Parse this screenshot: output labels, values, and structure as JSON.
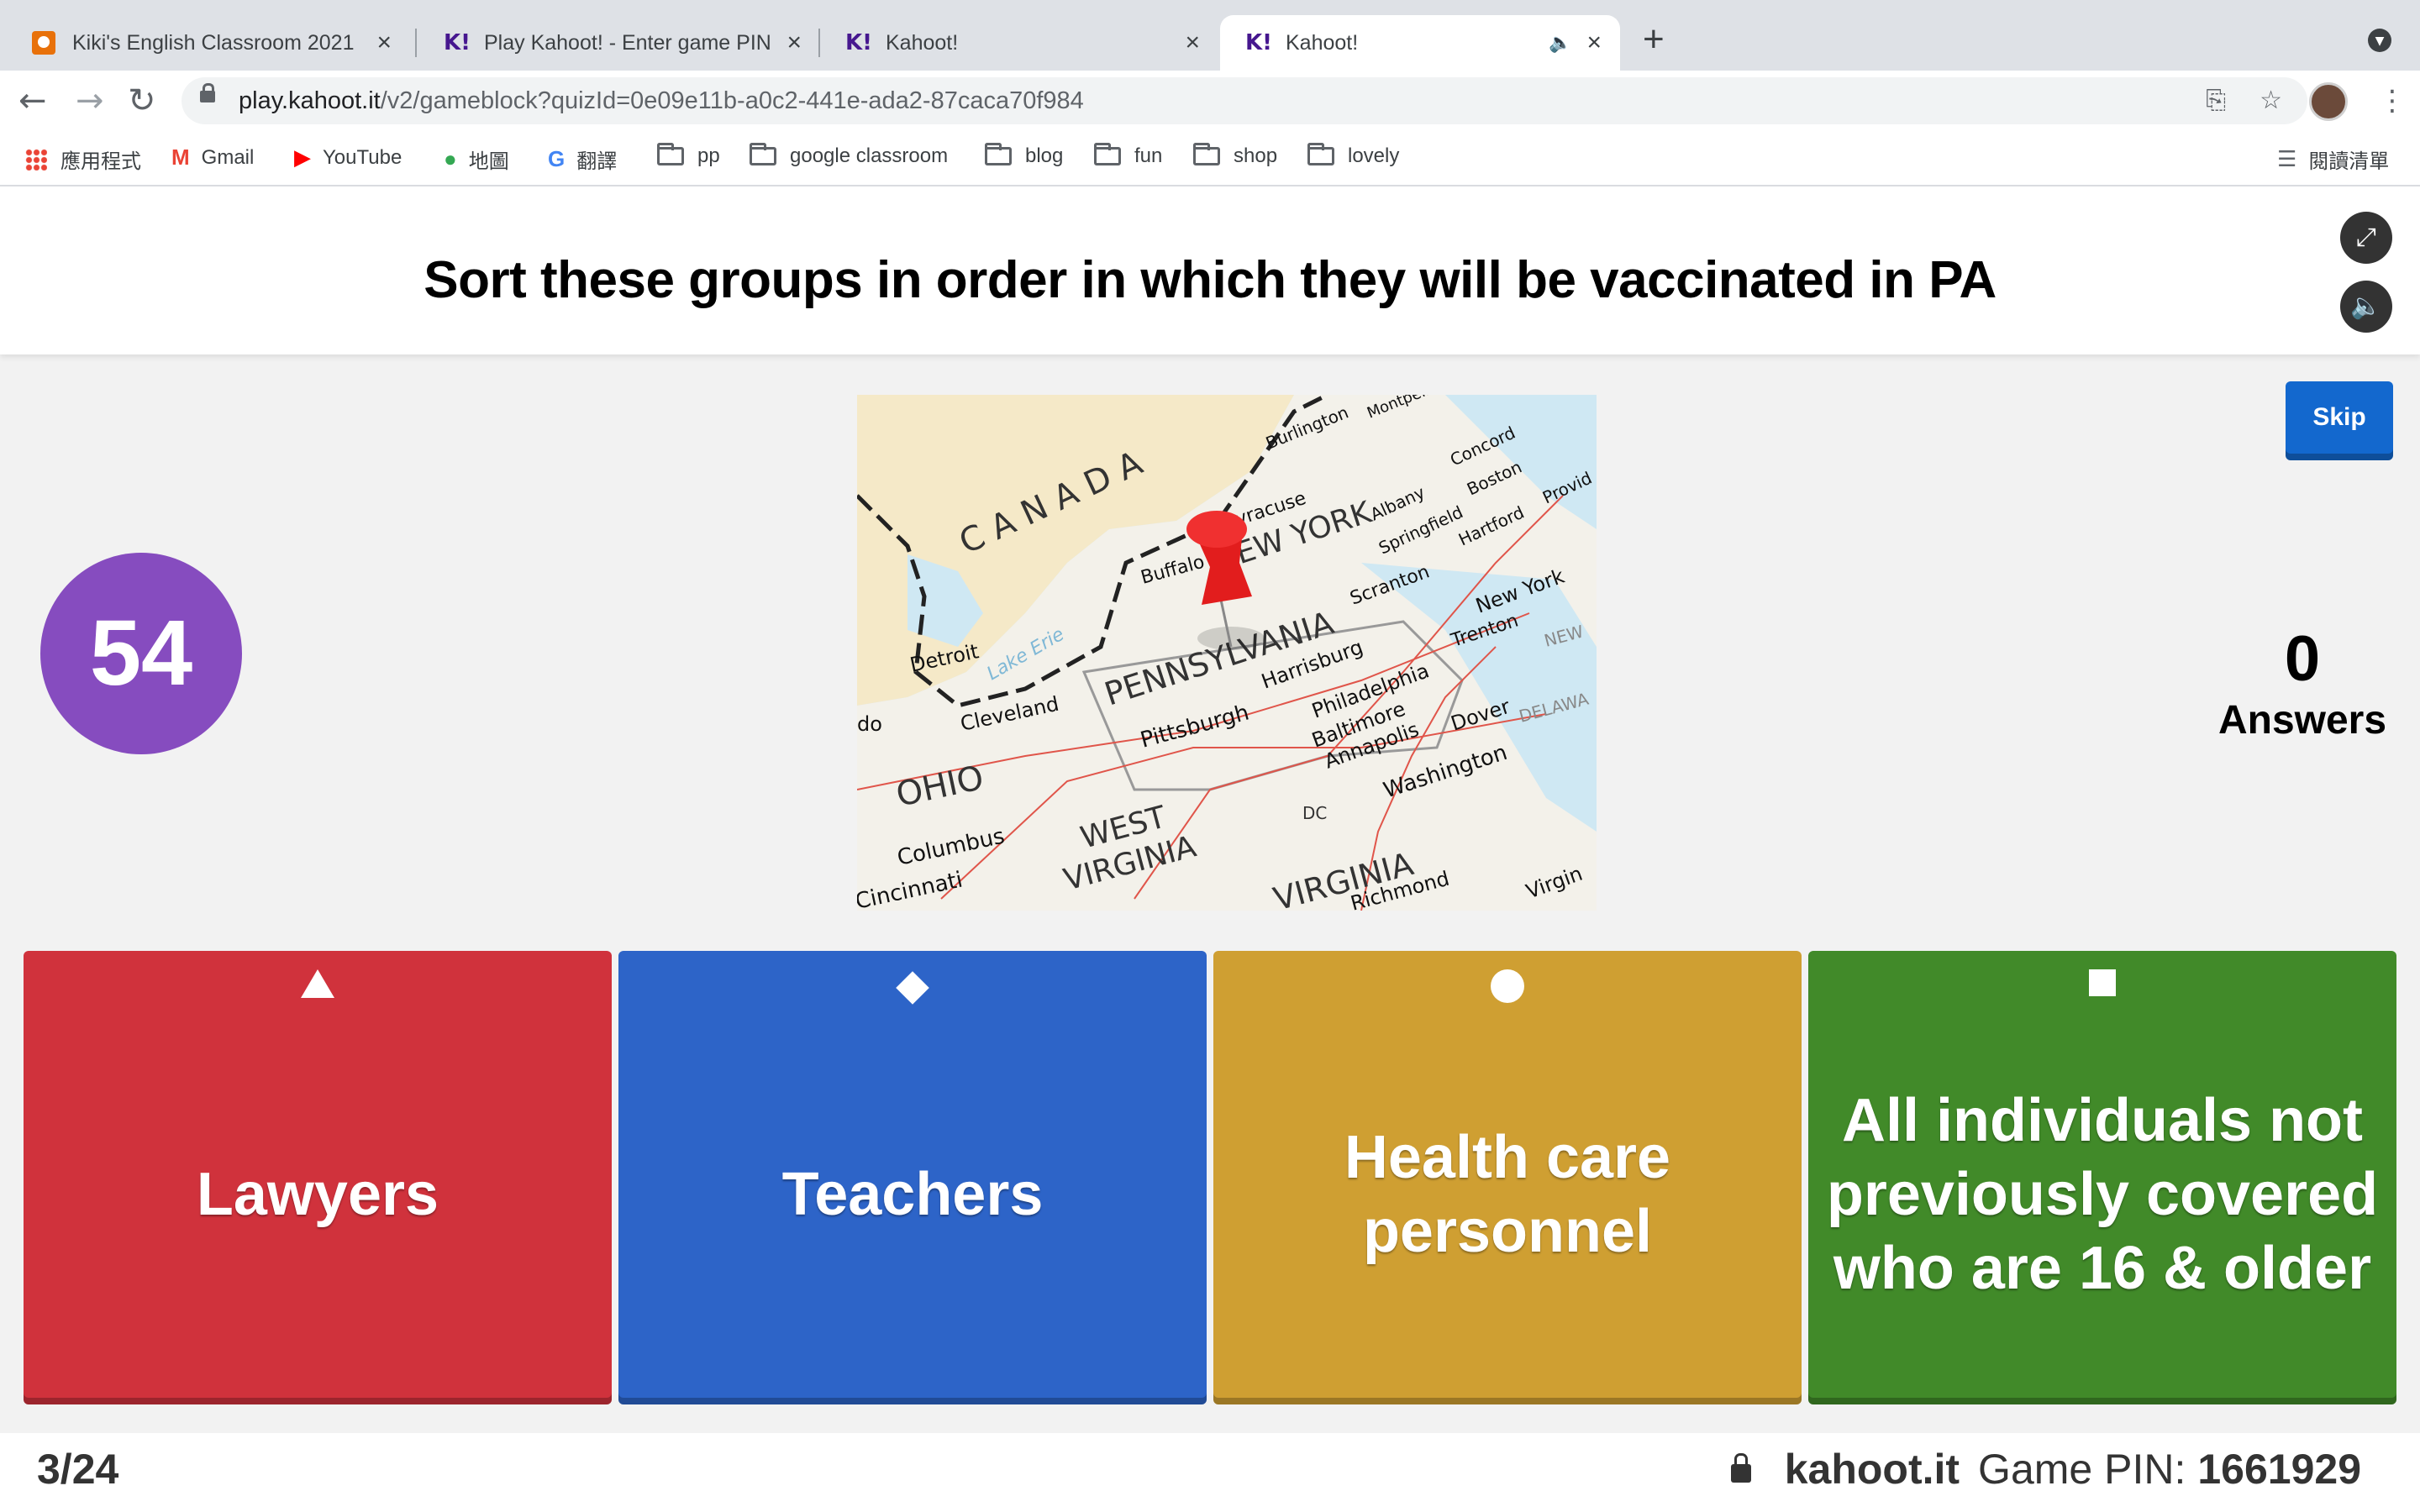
{
  "browser": {
    "tabs": [
      {
        "title": "Kiki's English Classroom 2021",
        "favicon": "classroom-icon",
        "active": false
      },
      {
        "title": "Play Kahoot! - Enter game PIN",
        "favicon": "kahoot-icon",
        "active": false
      },
      {
        "title": "Kahoot!",
        "favicon": "kahoot-icon",
        "active": false
      },
      {
        "title": "Kahoot!",
        "favicon": "kahoot-icon",
        "active": true,
        "audio": true
      }
    ],
    "url_host": "play.kahoot.it",
    "url_path": "/v2/gameblock?quizId=0e09e11b-a0c2-441e-ada2-87caca70f984",
    "bookmarks": [
      {
        "label": "應用程式",
        "icon": "apps-grid-icon"
      },
      {
        "label": "Gmail",
        "icon": "gmail-icon"
      },
      {
        "label": "YouTube",
        "icon": "youtube-icon"
      },
      {
        "label": "地圖",
        "icon": "maps-icon"
      },
      {
        "label": "翻譯",
        "icon": "translate-icon"
      },
      {
        "label": "pp",
        "icon": "folder-icon"
      },
      {
        "label": "google classroom",
        "icon": "folder-icon"
      },
      {
        "label": "blog",
        "icon": "folder-icon"
      },
      {
        "label": "fun",
        "icon": "folder-icon"
      },
      {
        "label": "shop",
        "icon": "folder-icon"
      },
      {
        "label": "lovely",
        "icon": "folder-icon"
      }
    ],
    "reading_list": "閱讀清單"
  },
  "game": {
    "question": "Sort these groups in order in which they will be vaccinated in PA",
    "timer": "54",
    "answers_count": "0",
    "answers_label": "Answers",
    "skip_label": "Skip",
    "options": [
      {
        "text": "Lawyers",
        "shape": "triangle-icon",
        "color": "#d0323c"
      },
      {
        "text": "Teachers",
        "shape": "diamond-icon",
        "color": "#2d64c8"
      },
      {
        "text": "Health care personnel",
        "shape": "circle-icon",
        "color": "#cf9f32"
      },
      {
        "text": "All individuals not previously covered who are 16 & older",
        "shape": "square-icon",
        "color": "#418a29"
      }
    ],
    "question_number": "3/24",
    "site": "kahoot.it",
    "pin_label": "Game PIN:",
    "pin": "1661929"
  },
  "map_labels": {
    "canada": "C A N A D A",
    "new_york": "NEW YORK",
    "pennsylvania": "PENNSYLVANIA",
    "ohio": "OHIO",
    "west_virginia_1": "WEST",
    "west_virginia_2": "VIRGINIA",
    "virginia": "VIRGINIA",
    "buffalo": "Buffalo",
    "syracuse": "Syracuse",
    "detroit": "Detroit",
    "cleveland": "Cleveland",
    "pittsburgh": "Pittsburgh",
    "harrisburg": "Harrisburg",
    "scranton": "Scranton",
    "philadelphia": "Philadelphia",
    "baltimore": "Baltimore",
    "annapolis": "Annapolis",
    "washington": "Washington",
    "dover": "Dover",
    "trenton": "Trenton",
    "new_york_city": "New York",
    "hartford": "Hartford",
    "boston": "Boston",
    "concord": "Concord",
    "albany": "Albany",
    "springfield": "Springfield",
    "burlington": "Burlington",
    "montpelier": "Montpelier",
    "columbus": "Columbus",
    "cincinnati": "Cincinnati",
    "richmond": "Richmond",
    "providence": "Provid",
    "dc": "DC",
    "lake_erie": "Lake Erie",
    "delaware": "DELAWA",
    "new_j": "NEW",
    "do": "do",
    "virgin": "Virgin"
  }
}
